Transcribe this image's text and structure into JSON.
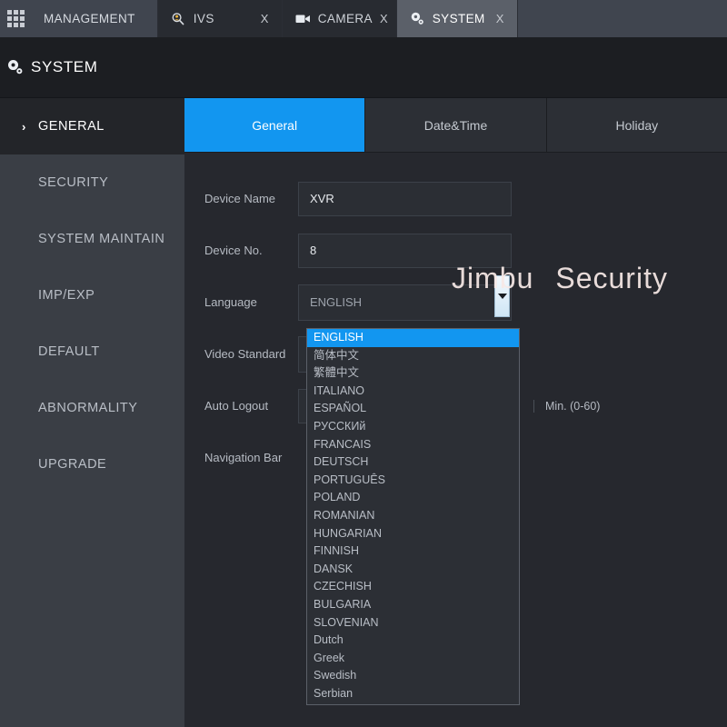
{
  "tabbar": {
    "menu_icon": "grid-icon",
    "tabs": [
      {
        "label": "MANAGEMENT",
        "icon": "grid-icon",
        "closable": false,
        "state": "normal"
      },
      {
        "label": "IVS",
        "icon": "magnifier-person-icon",
        "close_label": "X",
        "state": "normal"
      },
      {
        "label": "CAMERA",
        "icon": "video-camera-icon",
        "close_label": "X",
        "state": "normal"
      },
      {
        "label": "SYSTEM",
        "icon": "gear-icon",
        "close_label": "X",
        "state": "active"
      }
    ]
  },
  "module_header": {
    "title": "SYSTEM",
    "icon": "gear-icon"
  },
  "sidebar": {
    "items": [
      {
        "label": "GENERAL",
        "selected": true,
        "chevron": "›"
      },
      {
        "label": "SECURITY",
        "selected": false
      },
      {
        "label": "SYSTEM MAINTAIN",
        "selected": false
      },
      {
        "label": "IMP/EXP",
        "selected": false
      },
      {
        "label": "DEFAULT",
        "selected": false
      },
      {
        "label": "ABNORMALITY",
        "selected": false
      },
      {
        "label": "UPGRADE",
        "selected": false
      }
    ]
  },
  "subtabs": [
    {
      "label": "General",
      "active": true
    },
    {
      "label": "Date&Time",
      "active": false
    },
    {
      "label": "Holiday",
      "active": false
    }
  ],
  "form": {
    "device_name": {
      "label": "Device Name",
      "value": "XVR"
    },
    "device_no": {
      "label": "Device No.",
      "value": "8"
    },
    "language": {
      "label": "Language",
      "value": "ENGLISH"
    },
    "video_standard": {
      "label": "Video Standard",
      "value": ""
    },
    "auto_logout": {
      "label": "Auto Logout",
      "value": "",
      "unit": "Min. (0-60)"
    },
    "navigation_bar": {
      "label": "Navigation Bar",
      "value": ""
    }
  },
  "language_dropdown": {
    "selected": "ENGLISH",
    "options": [
      "ENGLISH",
      "简体中文",
      "繁體中文",
      "ITALIANO",
      "ESPAÑOL",
      "РУССКИй",
      "FRANCAIS",
      "DEUTSCH",
      "PORTUGUÊS",
      "POLAND",
      "ROMANIAN",
      "HUNGARIAN",
      "FINNISH",
      "DANSK",
      "CZECHISH",
      "BULGARIA",
      "SLOVENIAN",
      "Dutch",
      "Greek",
      "Swedish",
      "Serbian"
    ]
  },
  "watermark": {
    "part1": "Jimbu",
    "part2": "Security"
  },
  "colors": {
    "accent": "#1296f0",
    "tabbar_bg": "#40454f",
    "tab_active": "#5b6069",
    "sidebar_bg": "#3a3e45",
    "content_bg": "#26282e",
    "header_bg": "#1c1e22",
    "text": "#b9bec6"
  }
}
